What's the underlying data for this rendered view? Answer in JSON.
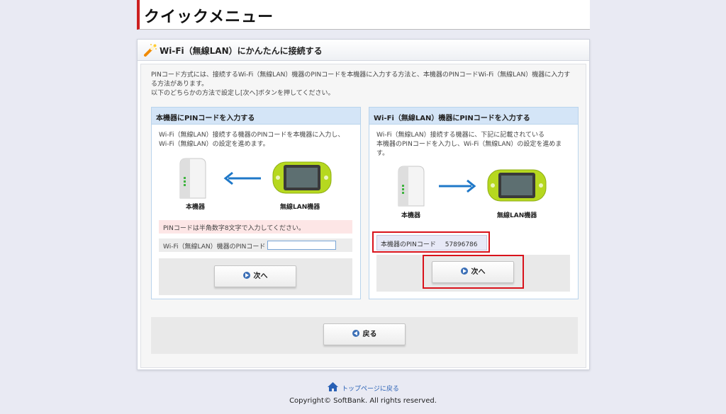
{
  "page": {
    "title": "クイックメニュー"
  },
  "panel": {
    "title": "Wi-Fi（無線LAN）にかんたんに接続する"
  },
  "intro": {
    "line1": "PINコード方式には、接続するWi-Fi（無線LAN）機器のPINコードを本機器に入力する方法と、本機器のPINコードWi-Fi（無線LAN）機器に入力す",
    "line2": "る方法があります。",
    "line3": "以下のどちらかの方法で設定し[次へ]ボタンを押してください。"
  },
  "left_box": {
    "title": "本機器にPINコードを入力する",
    "desc1": "Wi-Fi（無線LAN）接続する機器のPINコードを本機器に入力し、",
    "desc2": "Wi-Fi（無線LAN）の設定を進めます。",
    "router_caption": "本機器",
    "device_caption": "無線LAN機器",
    "pin_note": "PINコードは半角数字8文字で入力してください。",
    "pin_label": "Wi-Fi（無線LAN）機器のPINコード",
    "pin_value": "",
    "next_label": "次へ"
  },
  "right_box": {
    "title": "Wi-Fi（無線LAN）機器にPINコードを入力する",
    "desc1": "Wi-Fi（無線LAN）接続する機器に、下記に記載されている",
    "desc2": "本機器のPINコードを入力し、Wi-Fi（無線LAN）の設定を進めま",
    "desc3": "す。",
    "router_caption": "本機器",
    "device_caption": "無線LAN機器",
    "pin_label": "本機器のPINコード",
    "pin_code": "57896786",
    "next_label": "次へ"
  },
  "back_label": "戻る",
  "footer": {
    "top_link": "トップページに戻る",
    "copyright": "Copyright© SoftBank. All rights reserved."
  },
  "colors": {
    "accent_red": "#cc1f1f",
    "box_header": "#d4e5f7",
    "arrow_blue": "#1f78c8",
    "device_green": "#b6d81f"
  }
}
